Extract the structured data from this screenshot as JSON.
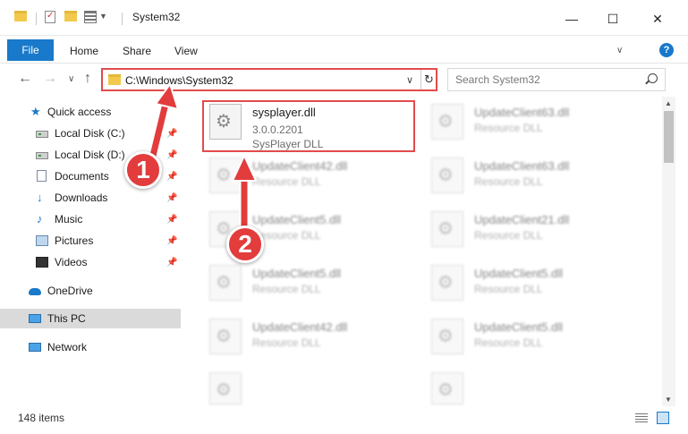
{
  "window": {
    "title": "System32",
    "minimize": "—",
    "maximize": "☐",
    "close": "✕"
  },
  "ribbon": {
    "file": "File",
    "tabs": [
      "Home",
      "Share",
      "View"
    ],
    "expand": "∨",
    "help": "?"
  },
  "navigation": {
    "back": "←",
    "forward": "→",
    "recent": "∨",
    "up": "↑",
    "address": "C:\\Windows\\System32",
    "address_dropdown": "∨",
    "refresh": "↻",
    "search_placeholder": "Search System32"
  },
  "sidebar": {
    "items": [
      {
        "label": "Quick access",
        "icon": "star-icon"
      },
      {
        "label": "Local Disk (C:)",
        "icon": "drive-icon",
        "pinned": true
      },
      {
        "label": "Local Disk (D:)",
        "icon": "drive-icon",
        "pinned": true
      },
      {
        "label": "Documents",
        "icon": "documents-icon",
        "pinned": true
      },
      {
        "label": "Downloads",
        "icon": "download-icon",
        "pinned": true
      },
      {
        "label": "Music",
        "icon": "music-icon",
        "pinned": true
      },
      {
        "label": "Pictures",
        "icon": "pictures-icon",
        "pinned": true
      },
      {
        "label": "Videos",
        "icon": "videos-icon",
        "pinned": true
      },
      {
        "label": "OneDrive",
        "icon": "cloud-icon"
      },
      {
        "label": "This PC",
        "icon": "computer-icon",
        "selected": true
      },
      {
        "label": "Network",
        "icon": "network-icon"
      }
    ],
    "pin_glyph": "📌"
  },
  "files": [
    {
      "name": "sysplayer.dll",
      "version": "3.0.0.2201",
      "description": "SysPlayer DLL",
      "highlighted": true
    },
    {
      "name": "UpdateClient63.dll",
      "description": "Resource DLL"
    },
    {
      "name": "UpdateClient42.dll",
      "description": "Resource DLL"
    },
    {
      "name": "UpdateClient63.dll",
      "description": "Resource DLL"
    },
    {
      "name": "UpdateClient5.dll",
      "description": "Resource DLL"
    },
    {
      "name": "UpdateClient21.dll",
      "description": "Resource DLL"
    },
    {
      "name": "UpdateClient5.dll",
      "description": "Resource DLL"
    },
    {
      "name": "UpdateClient5.dll",
      "description": "Resource DLL"
    },
    {
      "name": "UpdateClient42.dll",
      "description": "Resource DLL"
    },
    {
      "name": "UpdateClient5.dll",
      "description": "Resource DLL"
    }
  ],
  "status": {
    "item_count": "148 items"
  },
  "annotations": {
    "step1": "1",
    "step2": "2"
  },
  "colors": {
    "accent": "#1979ca",
    "highlight": "#e24b4b"
  }
}
